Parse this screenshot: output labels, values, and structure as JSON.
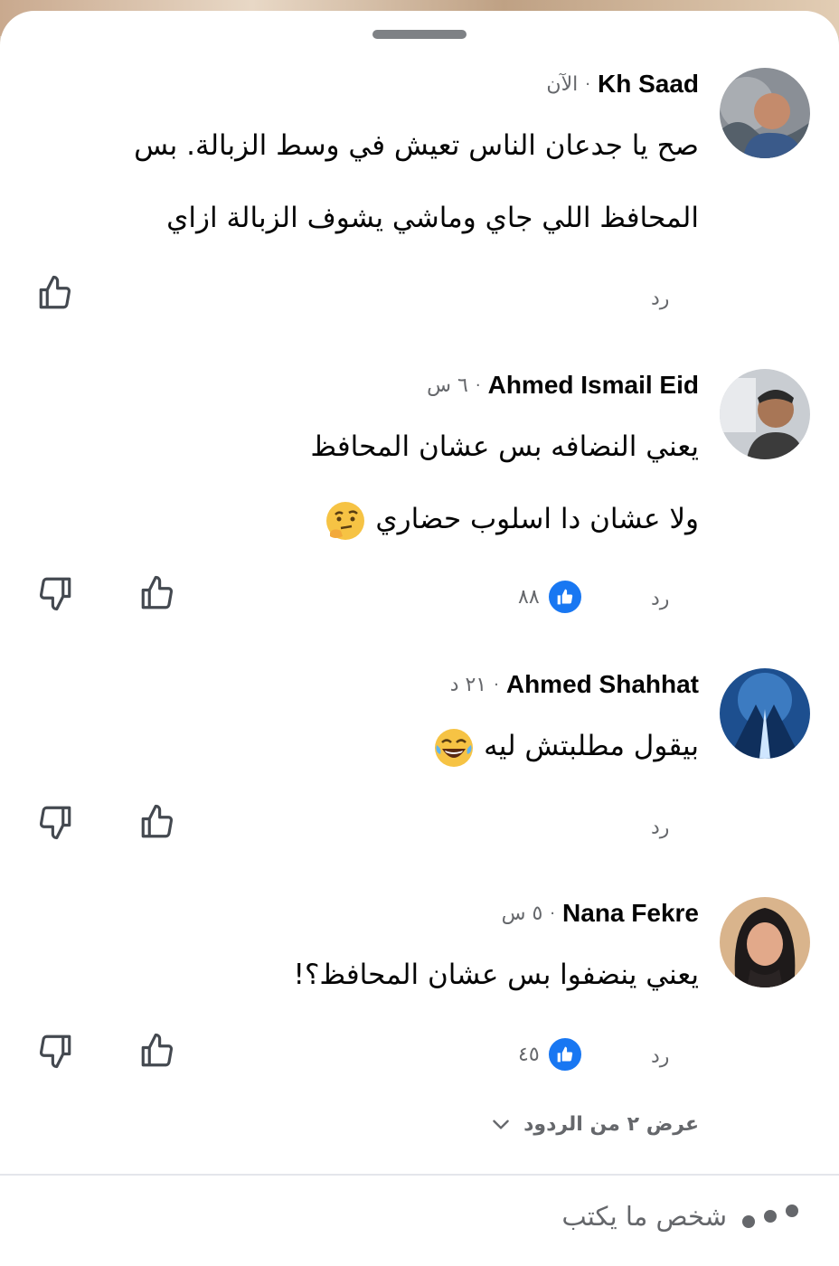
{
  "comments": [
    {
      "author": "Kh Saad",
      "time": "الآن",
      "lines": [
        "صح يا جدعان الناس تعيش في وسط الزبالة.   بس",
        "المحافظ اللي جاي وماشي يشوف الزبالة ازاي"
      ],
      "reply": "رد",
      "likes": null
    },
    {
      "author": "Ahmed Ismail Eid",
      "time": "٦ س",
      "lines": [
        "يعني النضافه بس عشان المحافظ",
        "ولا عشان دا اسلوب حضاري"
      ],
      "reply": "رد",
      "likes": "٨٨"
    },
    {
      "author": "Ahmed Shahhat",
      "time": "٢١ د",
      "lines": [
        "بيقول مطلبتش ليه"
      ],
      "reply": "رد",
      "likes": null
    },
    {
      "author": "Nana Fekre",
      "time": "٥ س",
      "lines": [
        "يعني ينضفوا بس عشان المحافظ؟!"
      ],
      "reply": "رد",
      "likes": "٤٥"
    }
  ],
  "view_replies": "عرض ٢ من الردود",
  "typing_indicator": "شخص ما يكتب",
  "separator": "·",
  "colors": {
    "like_blue": "#1877f2",
    "secondary_text": "#65676b",
    "primary_text": "#050505"
  },
  "icons": [
    "thumbs-up-icon",
    "thumbs-down-icon",
    "chevron-down-icon",
    "typing-dots-icon",
    "thinking-emoji",
    "laughing-emoji"
  ]
}
